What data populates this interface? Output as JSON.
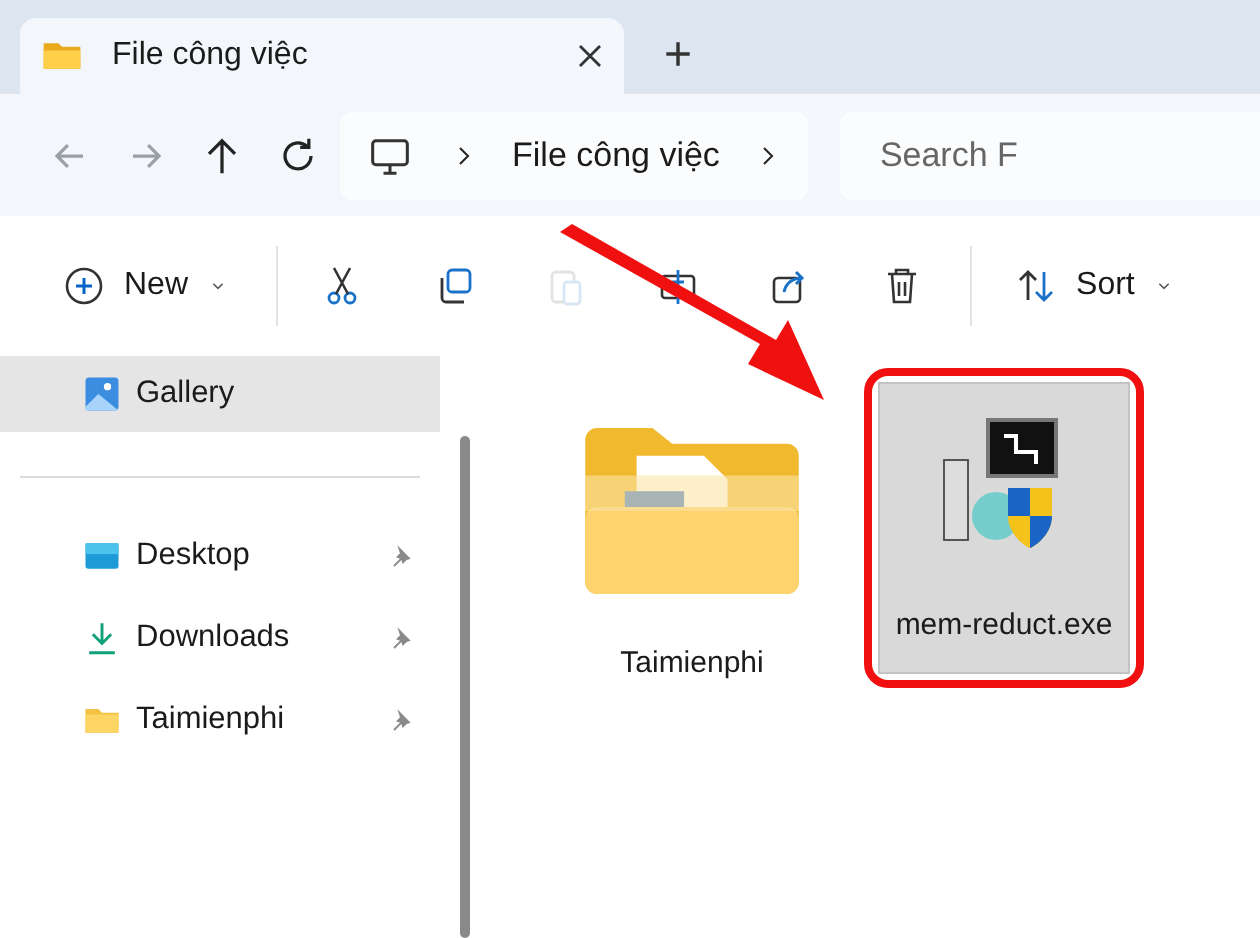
{
  "tabs": [
    {
      "label": "File công việc",
      "selected": true
    }
  ],
  "new_tab": {
    "label": "+"
  },
  "address_bar": {
    "path": [
      "File công việc"
    ]
  },
  "search": {
    "placeholder": "Search F"
  },
  "toolbar": [
    {
      "kind": "new",
      "label": "New",
      "disabled": false
    },
    {
      "kind": "cut",
      "disabled": false
    },
    {
      "kind": "copy",
      "disabled": false
    },
    {
      "kind": "paste",
      "disabled": true
    },
    {
      "kind": "rename",
      "disabled": false
    },
    {
      "kind": "share",
      "disabled": false
    },
    {
      "kind": "delete",
      "disabled": false
    },
    {
      "kind": "sort",
      "label": "Sort",
      "disabled": false
    }
  ],
  "sidebar": {
    "items": [
      {
        "kind": "gallery",
        "label": "Gallery",
        "selected": true,
        "pinned": false
      },
      {
        "kind": "desktop",
        "label": "Desktop",
        "selected": false,
        "pinned": true
      },
      {
        "kind": "downloads",
        "label": "Downloads",
        "selected": false,
        "pinned": true
      },
      {
        "kind": "folder",
        "label": "Taimienphi",
        "selected": false,
        "pinned": true
      }
    ]
  },
  "files": [
    {
      "kind": "folder",
      "name": "Taimienphi",
      "selected": false,
      "highlighted": false
    },
    {
      "kind": "exe",
      "name": "mem-reduct.exe",
      "selected": true,
      "highlighted": true
    }
  ]
}
